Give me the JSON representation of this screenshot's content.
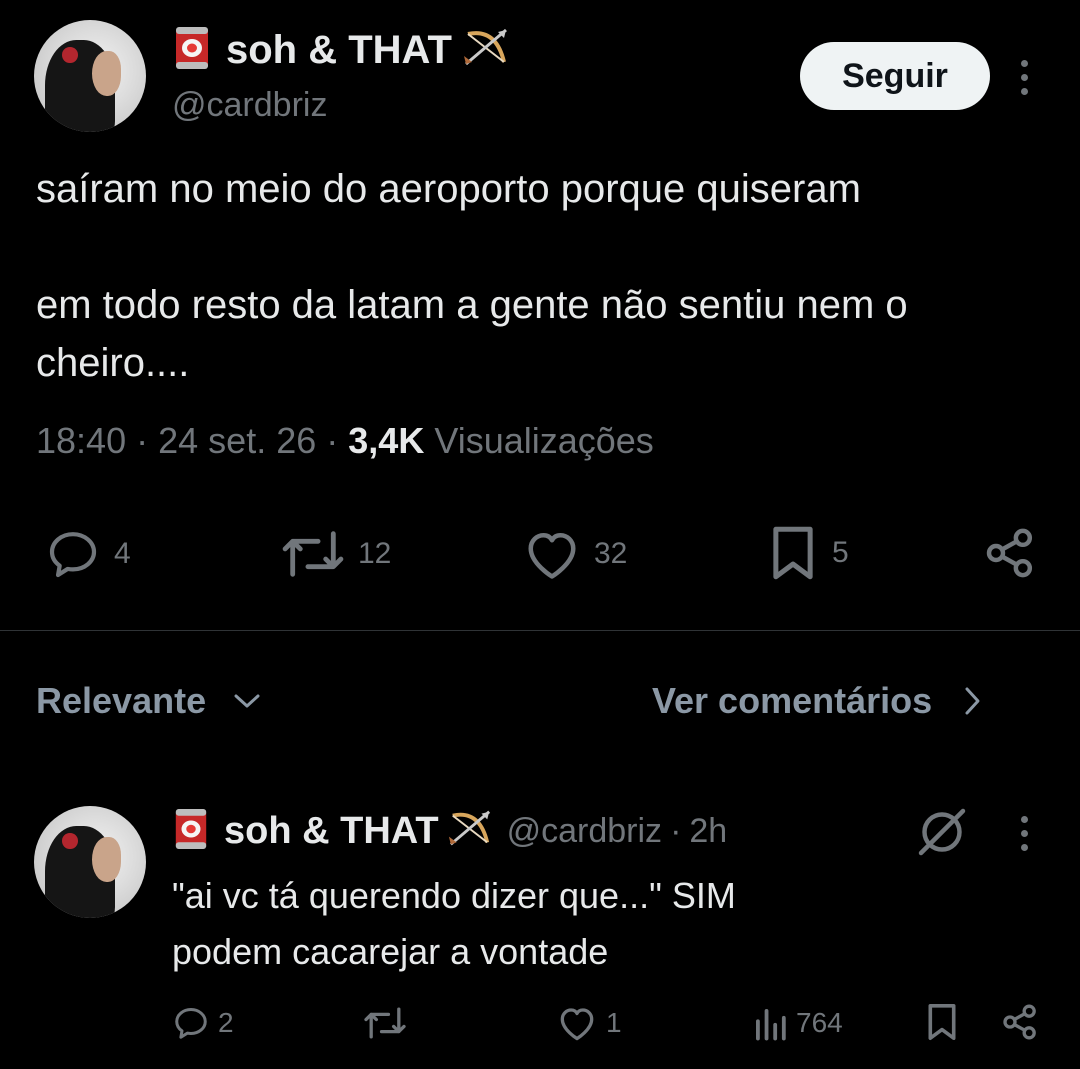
{
  "tweet": {
    "display_name": "soh & THAT",
    "handle": "@cardbriz",
    "follow_label": "Seguir",
    "text": "saíram no meio do aeroporto porque quiseram\n\nem todo resto da latam a gente não sentiu nem o cheiro....",
    "time": "18:40",
    "date": "24 set. 26",
    "views_count": "3,4K",
    "views_label": "Visualizações",
    "separator": "·",
    "actions": {
      "replies": "4",
      "retweets": "12",
      "likes": "32",
      "bookmarks": "5"
    }
  },
  "filters": {
    "sort_label": "Relevante",
    "comments_label": "Ver comentários"
  },
  "reply": {
    "display_name": "soh & THAT",
    "handle": "@cardbriz",
    "time": "2h",
    "separator": "·",
    "text": "\"ai vc tá querendo dizer que...\" SIM\npodem cacarejar a vontade",
    "actions": {
      "replies": "2",
      "likes": "1",
      "views": "764"
    }
  },
  "icons": {
    "emoji_can": "canned-food-icon",
    "emoji_bow": "bow-and-arrow-icon",
    "reply": "reply-icon",
    "retweet": "retweet-icon",
    "like": "heart-icon",
    "bookmark": "bookmark-icon",
    "share": "share-icon",
    "views": "views-icon",
    "more": "more-dots-icon",
    "grok": "grok-icon"
  },
  "colors": {
    "background": "#000000",
    "text": "#e7e9ea",
    "muted": "#71767b",
    "button_bg": "#eff3f4",
    "divider": "#2f3336"
  }
}
